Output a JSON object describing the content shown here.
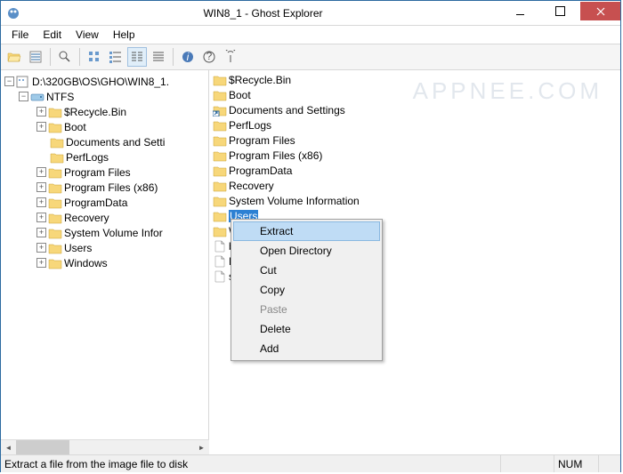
{
  "window": {
    "title": "WIN8_1 - Ghost Explorer"
  },
  "menubar": {
    "items": [
      "File",
      "Edit",
      "View",
      "Help"
    ]
  },
  "tree": {
    "root": "D:\\320GB\\OS\\GHO\\WIN8_1.",
    "partition": "NTFS",
    "items": [
      "$Recycle.Bin",
      "Boot",
      "Documents and Setti",
      "PerfLogs",
      "Program Files",
      "Program Files (x86)",
      "ProgramData",
      "Recovery",
      "System Volume Infor",
      "Users",
      "Windows"
    ]
  },
  "list": {
    "items": [
      {
        "name": "$Recycle.Bin",
        "type": "folder"
      },
      {
        "name": "Boot",
        "type": "folder"
      },
      {
        "name": "Documents and Settings",
        "type": "link"
      },
      {
        "name": "PerfLogs",
        "type": "folder"
      },
      {
        "name": "Program Files",
        "type": "folder"
      },
      {
        "name": "Program Files (x86)",
        "type": "folder"
      },
      {
        "name": "ProgramData",
        "type": "folder"
      },
      {
        "name": "Recovery",
        "type": "folder"
      },
      {
        "name": "System Volume Information",
        "type": "folder"
      },
      {
        "name": "Users",
        "type": "folder",
        "selected": true
      },
      {
        "name": "Windo",
        "type": "folder"
      },
      {
        "name": "bootm",
        "type": "file"
      },
      {
        "name": "BOOT",
        "type": "file"
      },
      {
        "name": "swap",
        "type": "file"
      }
    ]
  },
  "contextmenu": {
    "items": [
      {
        "label": "Extract",
        "hover": true
      },
      {
        "label": "Open Directory"
      },
      {
        "label": "Cut"
      },
      {
        "label": "Copy"
      },
      {
        "label": "Paste",
        "disabled": true
      },
      {
        "label": "Delete"
      },
      {
        "label": "Add"
      }
    ]
  },
  "statusbar": {
    "text": "Extract a file from the image file to disk",
    "num": "NUM"
  },
  "watermark": "APPNEE.COM"
}
